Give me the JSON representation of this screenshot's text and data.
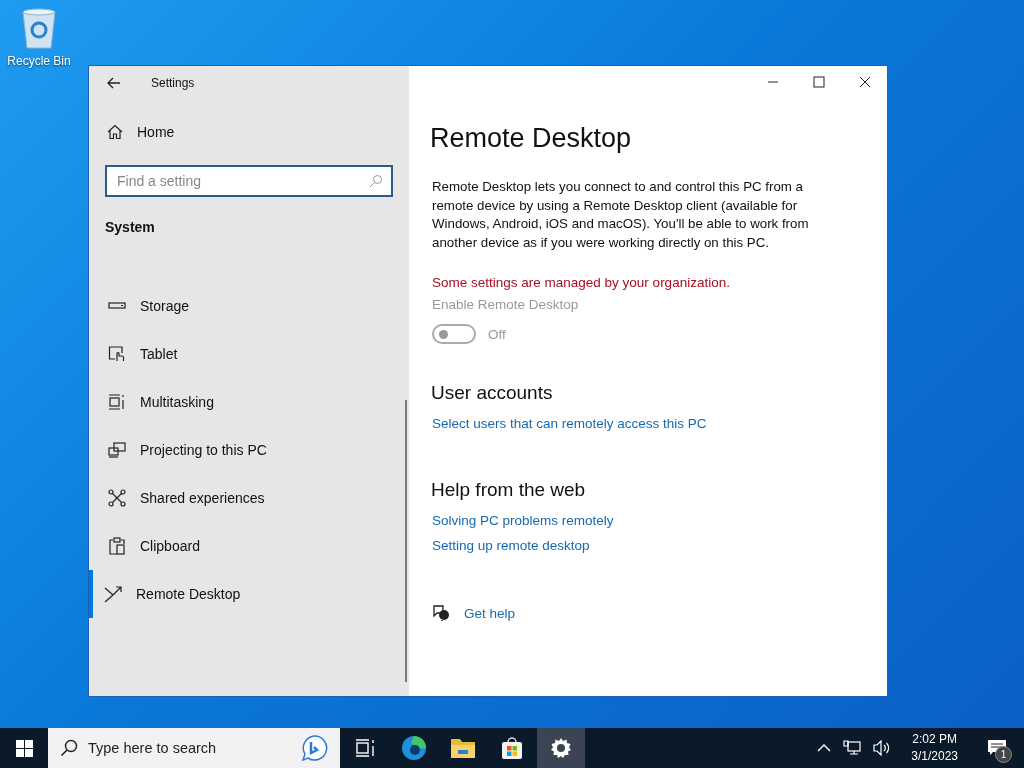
{
  "desktop_icons": [
    {
      "label": "Recycle Bin"
    }
  ],
  "window": {
    "title": "Settings"
  },
  "sidebar": {
    "home": "Home",
    "search": {
      "placeholder": "Find a setting"
    },
    "section": "System",
    "items": [
      {
        "label": "Storage",
        "kind": "storage",
        "selected": false
      },
      {
        "label": "Tablet",
        "kind": "tablet",
        "selected": false
      },
      {
        "label": "Multitasking",
        "kind": "multitasking",
        "selected": false
      },
      {
        "label": "Projecting to this PC",
        "kind": "projecting",
        "selected": false
      },
      {
        "label": "Shared experiences",
        "kind": "shared",
        "selected": false
      },
      {
        "label": "Clipboard",
        "kind": "clipboard",
        "selected": false
      },
      {
        "label": "Remote Desktop",
        "kind": "remote",
        "selected": true
      }
    ]
  },
  "content": {
    "title": "Remote Desktop",
    "description": "Remote Desktop lets you connect to and control this PC from a remote device by using a Remote Desktop client (available for Windows, Android, iOS and macOS). You'll be able to work from another device as if you were working directly on this PC.",
    "warning": "Some settings are managed by your organization.",
    "toggle": {
      "label": "Enable Remote Desktop",
      "on": false,
      "disabled": true,
      "state_text": "Off"
    },
    "sections": [
      {
        "heading": "User accounts",
        "links": [
          "Select users that can remotely access this PC"
        ]
      },
      {
        "heading": "Help from the web",
        "links": [
          "Solving PC problems remotely",
          "Setting up remote desktop"
        ]
      }
    ],
    "get_help": "Get help"
  },
  "taskbar": {
    "search": {
      "placeholder": "Type here to search"
    },
    "apps": [
      {
        "kind": "taskview",
        "active": false
      },
      {
        "kind": "edge",
        "active": false
      },
      {
        "kind": "explorer",
        "active": false
      },
      {
        "kind": "store",
        "active": false
      },
      {
        "kind": "settings",
        "active": true
      }
    ],
    "time": "2:02 PM",
    "date": "3/1/2023",
    "notifications": "1"
  }
}
